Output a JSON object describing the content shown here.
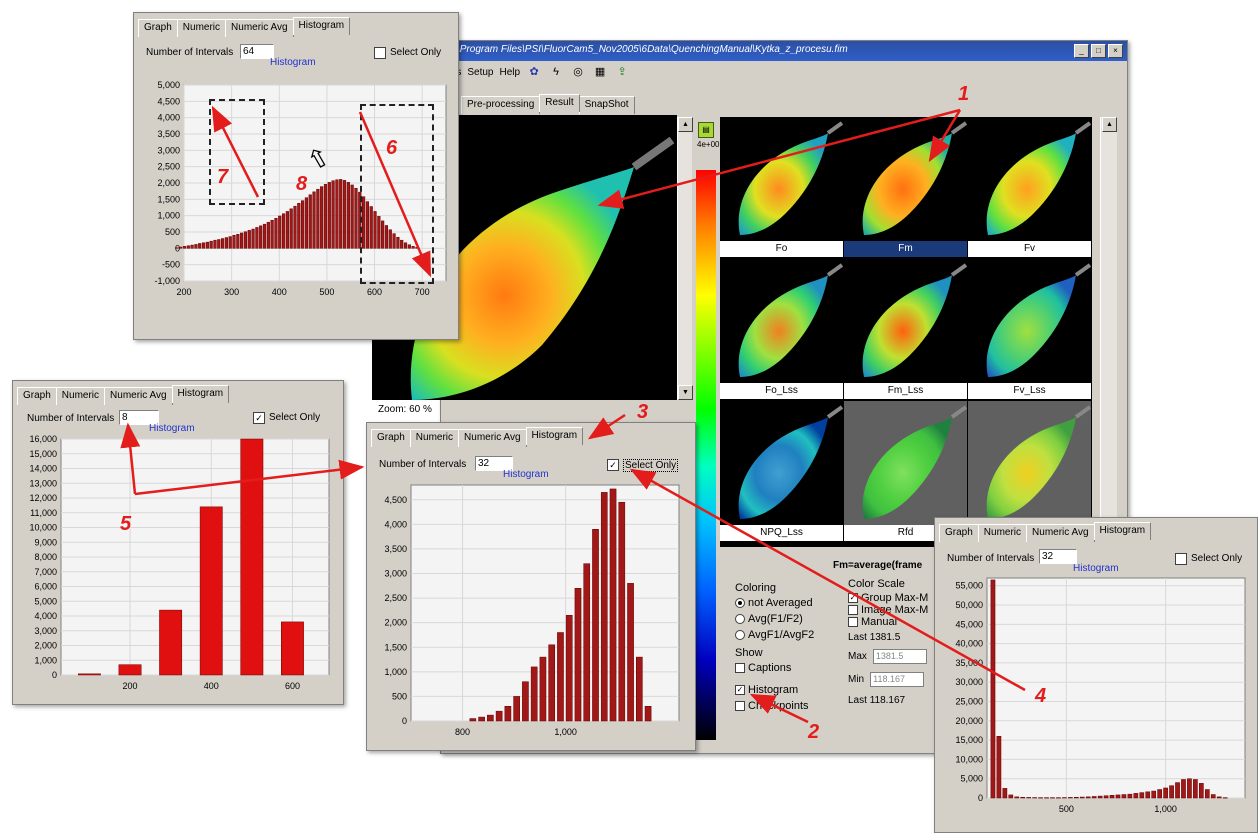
{
  "main_window": {
    "title": "C:\\Program Files\\PSI\\FluorCam5_Nov2005\\6Data\\QuenchingManual\\Kytka_z_procesu.fim",
    "menu": [
      "ools",
      "Setup",
      "Help"
    ],
    "tabs": [
      "Pre-processing",
      "Result",
      "SnapShot"
    ],
    "active_tab": "Result",
    "zoom_label": "Zoom: 60 %",
    "thumbnails": [
      {
        "label": "Fo",
        "selected": false
      },
      {
        "label": "Fm",
        "selected": true
      },
      {
        "label": "Fv",
        "selected": false
      },
      {
        "label": "Fo_Lss",
        "selected": false
      },
      {
        "label": "Fm_Lss",
        "selected": false
      },
      {
        "label": "Fv_Lss",
        "selected": false
      },
      {
        "label": "NPQ_Lss",
        "selected": false
      },
      {
        "label": "Rfd",
        "selected": false
      },
      {
        "label": "",
        "selected": false
      }
    ],
    "colorbar_top_label": "4e+00",
    "info_heading": "Fm=average(frame",
    "coloring": {
      "heading": "Coloring",
      "options": [
        "not Averaged",
        "Avg(F1/F2)",
        "AvgF1/AvgF2"
      ],
      "selected": "not Averaged"
    },
    "show": {
      "heading": "Show",
      "items": [
        {
          "label": "Captions",
          "checked": false
        },
        {
          "label": "Histogram",
          "checked": true
        },
        {
          "label": "Checkpoints",
          "checked": false
        }
      ]
    },
    "color_scale": {
      "heading": "Color Scale",
      "options": [
        "Group Max-M",
        "Image Max-M",
        "Manual"
      ],
      "last_label": "Last",
      "last_value": "1381.5",
      "max_label": "Max",
      "max_value": "1381.5",
      "min_label": "Min",
      "min_value": "118.167",
      "last2_label": "Last",
      "last2_value": "118.167"
    }
  },
  "histogram_panels": {
    "tab_labels": [
      "Graph",
      "Numeric",
      "Numeric Avg",
      "Histogram"
    ],
    "intervals_label": "Number of Intervals",
    "select_only_label": "Select Only",
    "link_label": "Histogram"
  },
  "top_left": {
    "intervals": "64",
    "select_only": false
  },
  "mid_left": {
    "intervals": "8",
    "select_only": true
  },
  "center": {
    "intervals": "32",
    "select_only": true
  },
  "bottom_right": {
    "intervals": "32",
    "select_only": false
  },
  "callouts": [
    "1",
    "2",
    "3",
    "4",
    "5",
    "6",
    "7",
    "8"
  ],
  "chart_data": [
    {
      "type": "bar",
      "panel": "top_left",
      "x": [
        185,
        193,
        201,
        209,
        217,
        225,
        233,
        241,
        249,
        257,
        265,
        273,
        281,
        289,
        297,
        305,
        313,
        321,
        329,
        337,
        345,
        353,
        361,
        369,
        377,
        385,
        393,
        401,
        409,
        417,
        425,
        433,
        441,
        449,
        457,
        465,
        473,
        481,
        489,
        497,
        505,
        513,
        521,
        529,
        537,
        545,
        553,
        561,
        569,
        577,
        585,
        593,
        601,
        609,
        617,
        625,
        633,
        641,
        649,
        657,
        665,
        673,
        681,
        689
      ],
      "values": [
        20,
        40,
        60,
        80,
        100,
        120,
        150,
        170,
        190,
        220,
        250,
        270,
        300,
        330,
        360,
        400,
        430,
        470,
        510,
        550,
        590,
        640,
        690,
        740,
        800,
        860,
        920,
        990,
        1060,
        1130,
        1210,
        1290,
        1380,
        1460,
        1550,
        1640,
        1730,
        1810,
        1890,
        1960,
        2020,
        2070,
        2100,
        2110,
        2080,
        2020,
        1940,
        1840,
        1720,
        1580,
        1430,
        1280,
        1130,
        980,
        840,
        700,
        570,
        450,
        340,
        250,
        170,
        110,
        60,
        30
      ],
      "xticks": [
        "200",
        "300",
        "400",
        "500",
        "600",
        "700"
      ],
      "yticks": [
        "5,000",
        "4,500",
        "4,000",
        "3,500",
        "3,000",
        "2,500",
        "2,000",
        "1,500",
        "1,000",
        "500",
        "0",
        "-500",
        "-1,000"
      ],
      "xlim": [
        200,
        750
      ],
      "ylim": [
        -1000,
        5000
      ],
      "color": "#a01818"
    },
    {
      "type": "bar",
      "panel": "mid_left",
      "x": [
        100,
        200,
        300,
        400,
        500,
        600
      ],
      "values": [
        80,
        700,
        4400,
        11400,
        16000,
        3600
      ],
      "xticks": [
        "200",
        "400",
        "600"
      ],
      "yticks": [
        "16,000",
        "15,000",
        "14,000",
        "13,000",
        "12,000",
        "11,000",
        "10,000",
        "9,000",
        "8,000",
        "7,000",
        "6,000",
        "5,000",
        "4,000",
        "3,000",
        "2,000",
        "1,000",
        "0"
      ],
      "xlim": [
        30,
        690
      ],
      "ylim": [
        0,
        16000
      ],
      "color": "#e01010"
    },
    {
      "type": "bar",
      "panel": "center",
      "x": [
        820,
        837,
        854,
        871,
        888,
        905,
        922,
        939,
        956,
        973,
        990,
        1007,
        1024,
        1041,
        1058,
        1075,
        1092,
        1109
      ],
      "values": [
        50,
        80,
        120,
        200,
        300,
        500,
        800,
        1100,
        1300,
        1550,
        1800,
        2150,
        2700,
        3200,
        3900,
        4650,
        4720,
        4450
      ],
      "extra_x": [
        1126,
        1143,
        1160
      ],
      "extra_values": [
        2800,
        1300,
        300
      ],
      "xticks": [
        "800",
        "1,000"
      ],
      "yticks": [
        "4,500",
        "4,000",
        "3,500",
        "3,000",
        "2,500",
        "2,000",
        "1,500",
        "1,000",
        "500",
        "0"
      ],
      "xlim": [
        700,
        1220
      ],
      "ylim": [
        0,
        4800
      ],
      "color": "#a01818"
    },
    {
      "type": "bar",
      "panel": "bottom_right",
      "x": [
        130,
        160,
        190,
        220,
        250,
        280,
        310,
        340,
        370,
        400,
        430,
        460,
        490,
        520,
        550,
        580,
        610,
        640,
        670,
        700,
        730,
        760,
        790,
        820,
        850,
        880,
        910,
        940,
        970,
        1000,
        1030,
        1060,
        1090,
        1120,
        1150,
        1180,
        1210,
        1240,
        1270,
        1300
      ],
      "values": [
        56500,
        16000,
        2500,
        800,
        300,
        200,
        150,
        120,
        100,
        100,
        100,
        100,
        120,
        150,
        200,
        250,
        300,
        400,
        500,
        600,
        700,
        800,
        900,
        1000,
        1200,
        1400,
        1600,
        1800,
        2200,
        2600,
        3200,
        4000,
        4800,
        5000,
        4800,
        3800,
        2200,
        900,
        300,
        100
      ],
      "xticks": [
        "500",
        "1,000"
      ],
      "yticks": [
        "55,000",
        "50,000",
        "45,000",
        "40,000",
        "35,000",
        "30,000",
        "25,000",
        "20,000",
        "15,000",
        "10,000",
        "5,000",
        "0"
      ],
      "xlim": [
        100,
        1400
      ],
      "ylim": [
        0,
        57000
      ],
      "color": "#a01818"
    }
  ]
}
